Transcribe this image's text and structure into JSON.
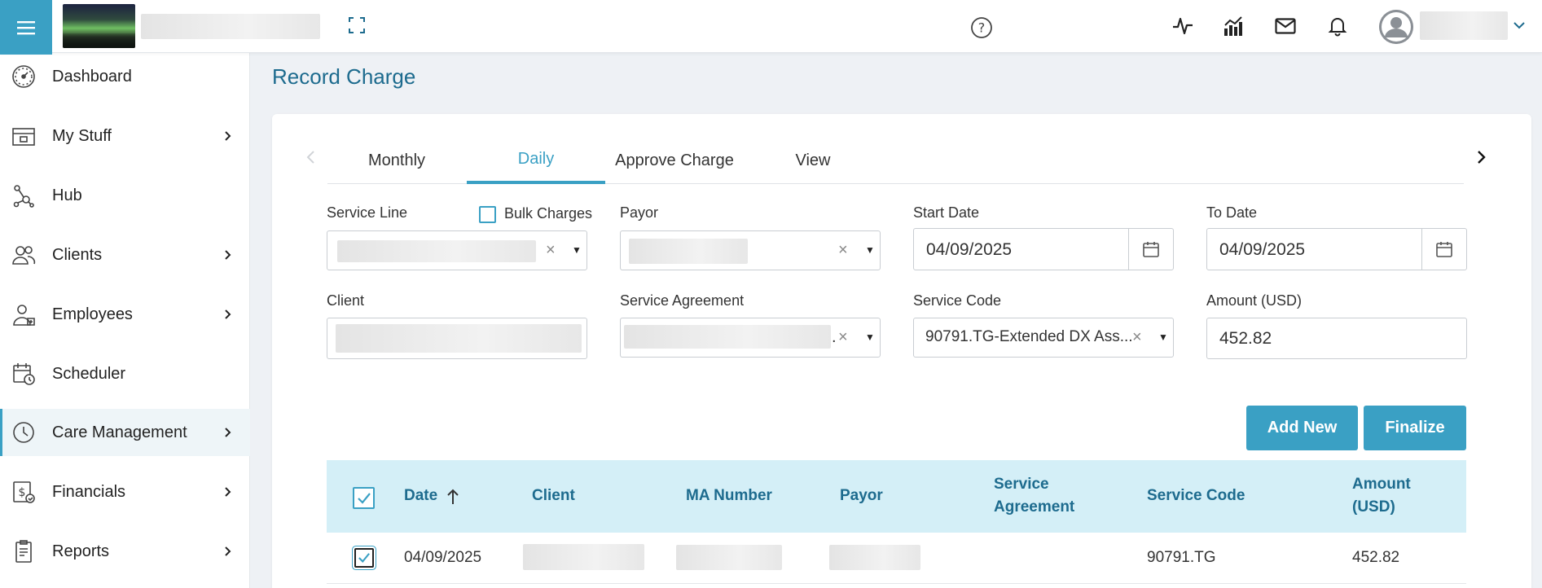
{
  "header": {
    "menu_icon": "hamburger-icon",
    "expand_icon": "fullscreen-icon",
    "help_icon": "help-circle-icon",
    "icons": [
      "activity-icon",
      "analytics-icon",
      "mail-icon",
      "bell-icon"
    ],
    "user_chevron_icon": "chevron-down-icon",
    "accent_color": "#3aa0c4"
  },
  "sidebar": {
    "items": [
      {
        "label": "Dashboard",
        "icon": "speedometer-icon",
        "has_submenu": false
      },
      {
        "label": "My Stuff",
        "icon": "inbox-icon",
        "has_submenu": true
      },
      {
        "label": "Hub",
        "icon": "hub-icon",
        "has_submenu": false
      },
      {
        "label": "Clients",
        "icon": "users-icon",
        "has_submenu": true
      },
      {
        "label": "Employees",
        "icon": "employee-icon",
        "has_submenu": true
      },
      {
        "label": "Scheduler",
        "icon": "calendar-clock-icon",
        "has_submenu": false
      },
      {
        "label": "Care Management",
        "icon": "clock-icon",
        "has_submenu": true,
        "active": true
      },
      {
        "label": "Financials",
        "icon": "dollar-icon",
        "has_submenu": true
      },
      {
        "label": "Reports",
        "icon": "clipboard-icon",
        "has_submenu": true
      }
    ]
  },
  "page": {
    "title": "Record Charge"
  },
  "tabs": {
    "items": [
      "Monthly",
      "Daily",
      "Approve Charge",
      "View"
    ],
    "active": "Daily"
  },
  "form": {
    "service_line_label": "Service Line",
    "bulk_charges_label": "Bulk Charges",
    "payor_label": "Payor",
    "start_date_label": "Start Date",
    "start_date_value": "04/09/2025",
    "to_date_label": "To Date",
    "to_date_value": "04/09/2025",
    "client_label": "Client",
    "service_agreement_label": "Service Agreement",
    "service_code_label": "Service Code",
    "service_code_value": "90791.TG-Extended DX Ass...",
    "amount_label": "Amount (USD)",
    "amount_value": "452.82",
    "clear_glyph": "×",
    "caret_glyph": "▼",
    "ellipsis": "."
  },
  "actions": {
    "add_new": "Add New",
    "finalize": "Finalize"
  },
  "table": {
    "headers": {
      "date": "Date",
      "client": "Client",
      "ma_number": "MA Number",
      "payor": "Payor",
      "service_agreement_1": "Service",
      "service_agreement_2": "Agreement",
      "service_code": "Service Code",
      "amount_1": "Amount",
      "amount_2": "(USD)"
    },
    "sort": "ascending",
    "rows": [
      {
        "date": "04/09/2025",
        "service_code": "90791.TG",
        "amount": "452.82",
        "checked": true
      }
    ]
  }
}
